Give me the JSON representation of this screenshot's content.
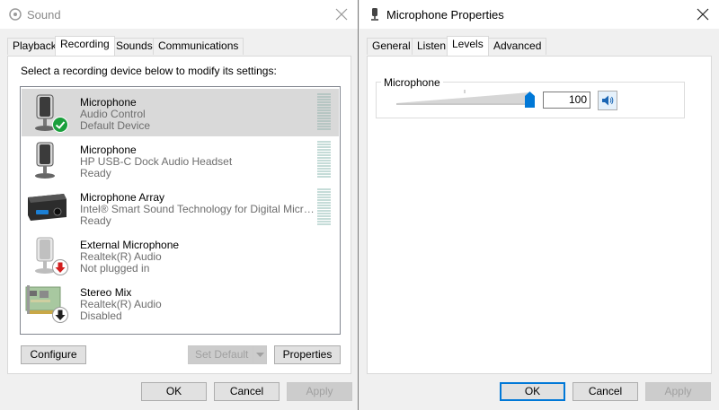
{
  "sound": {
    "title": "Sound",
    "tabs": [
      "Playback",
      "Recording",
      "Sounds",
      "Communications"
    ],
    "active_tab": "Recording",
    "instruction": "Select a recording device below to modify its settings:",
    "devices": [
      {
        "name": "Microphone",
        "desc": "Audio Control",
        "status": "Default Device",
        "icon": "microphone-icon",
        "badge": "green-check-icon",
        "selected": true
      },
      {
        "name": "Microphone",
        "desc": "HP USB-C Dock Audio Headset",
        "status": "Ready",
        "icon": "microphone-icon",
        "badge": "",
        "selected": false
      },
      {
        "name": "Microphone Array",
        "desc": "Intel® Smart Sound Technology for Digital Micro...",
        "status": "Ready",
        "icon": "webcam-array-icon",
        "badge": "",
        "selected": false
      },
      {
        "name": "External Microphone",
        "desc": "Realtek(R) Audio",
        "status": "Not plugged in",
        "icon": "microphone-icon",
        "badge": "red-down-arrow-icon",
        "selected": false
      },
      {
        "name": "Stereo Mix",
        "desc": "Realtek(R) Audio",
        "status": "Disabled",
        "icon": "sound-card-icon",
        "badge": "disabled-down-arrow-icon",
        "selected": false
      }
    ],
    "configure_label": "Configure",
    "set_default_label": "Set Default",
    "properties_label": "Properties",
    "ok_label": "OK",
    "cancel_label": "Cancel",
    "apply_label": "Apply"
  },
  "mic": {
    "title": "Microphone Properties",
    "tabs": [
      "General",
      "Listen",
      "Levels",
      "Advanced"
    ],
    "active_tab": "Levels",
    "level_group_label": "Microphone",
    "level_value": "100",
    "level_fraction": 1.0,
    "ok_label": "OK",
    "cancel_label": "Cancel",
    "apply_label": "Apply"
  },
  "colors": {
    "accent": "#0078d7",
    "selection": "#d9d9d9",
    "check_green": "#1a9f3c",
    "unplugged_red": "#d21f1f"
  }
}
